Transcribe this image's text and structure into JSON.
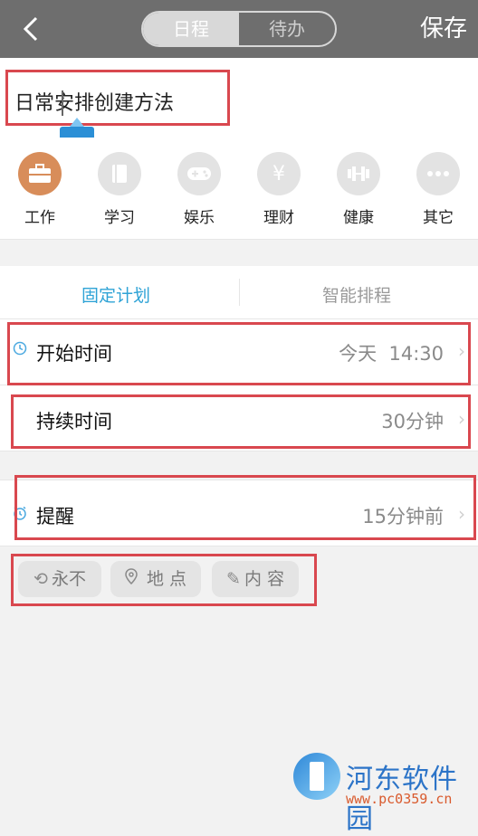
{
  "header": {
    "back_icon": "chevron-left-icon",
    "segment": [
      "日程",
      "待办"
    ],
    "save_label": "保存"
  },
  "title_input": {
    "value": "日常安排创建方法"
  },
  "categories": [
    {
      "label": "工作",
      "icon": "briefcase-icon",
      "active": true
    },
    {
      "label": "学习",
      "icon": "book-icon",
      "active": false
    },
    {
      "label": "娱乐",
      "icon": "gamepad-icon",
      "active": false
    },
    {
      "label": "理财",
      "icon": "yen-icon",
      "active": false
    },
    {
      "label": "健康",
      "icon": "dumbbell-icon",
      "active": false
    },
    {
      "label": "其它",
      "icon": "more-icon",
      "active": false
    }
  ],
  "plan_tabs": [
    {
      "label": "固定计划",
      "active": true
    },
    {
      "label": "智能排程",
      "active": false
    }
  ],
  "rows": {
    "start": {
      "label": "开始时间",
      "day": "今天",
      "time": "14:30"
    },
    "duration": {
      "label": "持续时间",
      "value": "30分钟"
    },
    "reminder": {
      "label": "提醒",
      "value": "15分钟前"
    }
  },
  "chips": [
    {
      "label": "永不",
      "icon": "repeat-icon"
    },
    {
      "label": "地 点",
      "icon": "location-pin-icon"
    },
    {
      "label": "内 容",
      "icon": "pencil-icon"
    }
  ],
  "watermark": {
    "title": "河东软件园",
    "url": "www.pc0359.cn"
  },
  "colors": {
    "accent": "#2fa3d6",
    "active_category": "#d88d5a",
    "highlight_box": "#d9484f",
    "header": "#6e6e6e"
  }
}
